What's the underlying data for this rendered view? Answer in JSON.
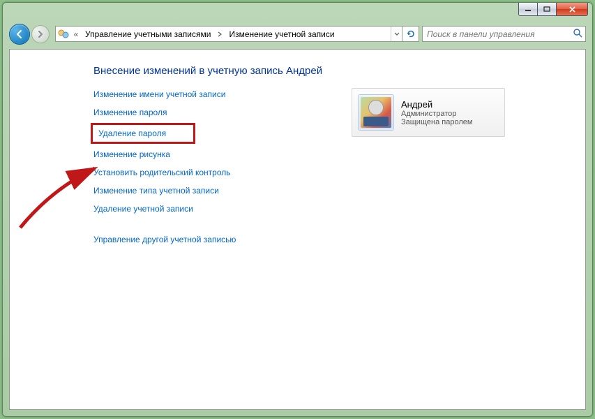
{
  "breadcrumb": {
    "level1": "Управление учетными записями",
    "level2": "Изменение учетной записи"
  },
  "search": {
    "placeholder": "Поиск в панели управления"
  },
  "heading": "Внесение изменений в учетную запись Андрей",
  "links": {
    "change_name": "Изменение имени учетной записи",
    "change_password": "Изменение пароля",
    "remove_password": "Удаление пароля",
    "change_picture": "Изменение рисунка",
    "parental_controls": "Установить родительский контроль",
    "change_type": "Изменение типа учетной записи",
    "delete_account": "Удаление учетной записи",
    "manage_other": "Управление другой учетной записью"
  },
  "user": {
    "name": "Андрей",
    "role": "Администратор",
    "status": "Защищена паролем"
  }
}
